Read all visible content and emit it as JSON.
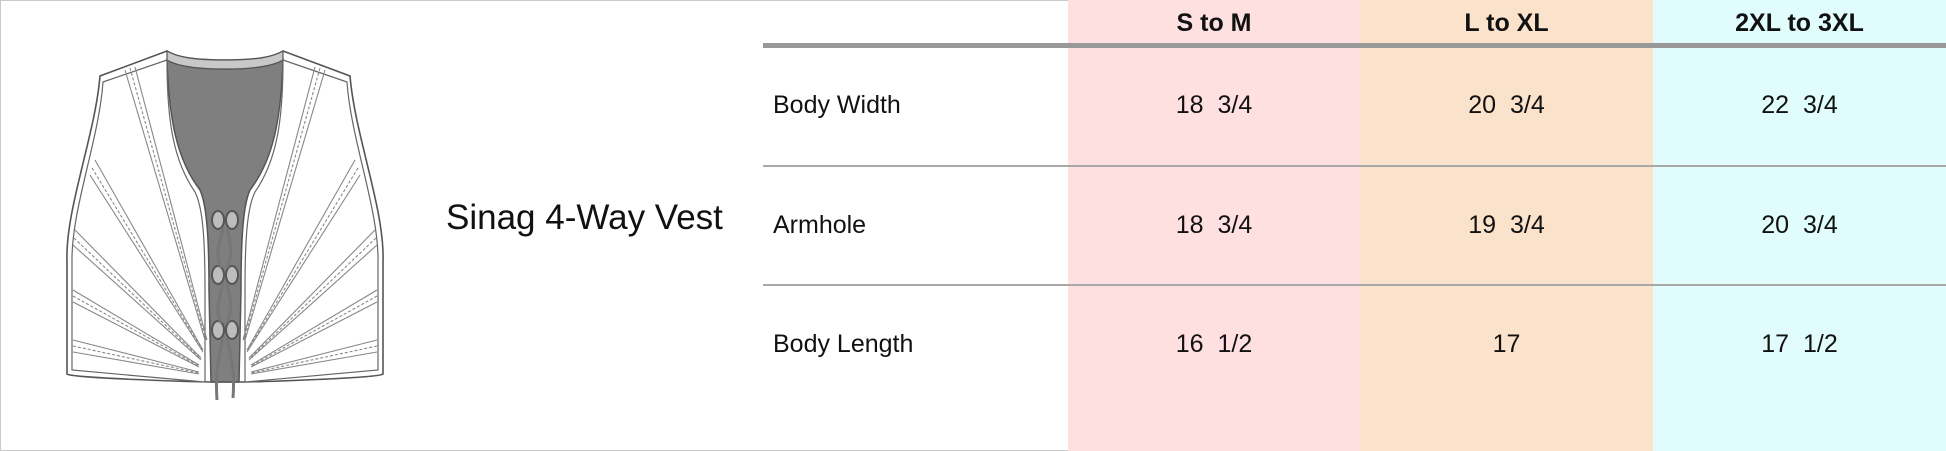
{
  "product": {
    "name": "Sinag 4-Way Vest"
  },
  "colors": {
    "s_to_m_bg": "#ffe0e0",
    "l_to_xl_bg": "#fbe3cb",
    "xl2_to_xl3_bg": "#e0fcfc",
    "garment_fill": "#7f7f7f",
    "rule": "#999999"
  },
  "table": {
    "headers": [
      "S to M",
      "L to XL",
      "2XL to 3XL"
    ],
    "rows": [
      {
        "label": "Body Width",
        "values": [
          "18  3/4",
          "20  3/4",
          "22  3/4"
        ]
      },
      {
        "label": "Armhole",
        "values": [
          "18  3/4",
          "19  3/4",
          "20  3/4"
        ]
      },
      {
        "label": "Body Length",
        "values": [
          "16  1/2",
          "17",
          "17  1/2"
        ]
      }
    ]
  },
  "icons": {
    "garment": "vest-flat-sketch"
  }
}
